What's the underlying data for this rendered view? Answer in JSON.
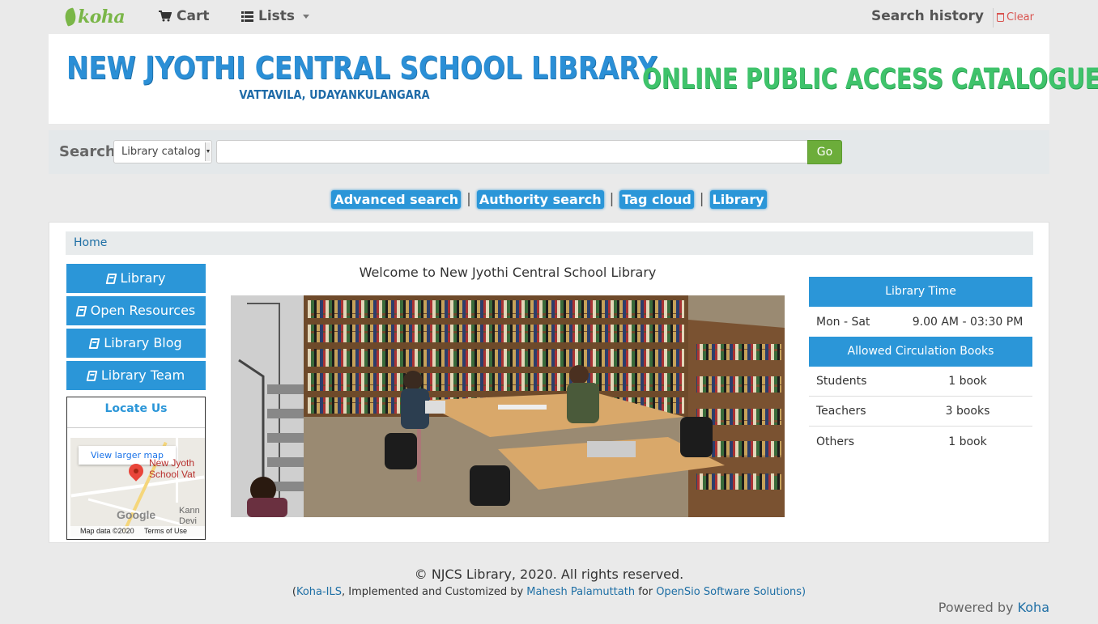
{
  "navbar": {
    "logo": "koha",
    "cart_label": "Cart",
    "lists_label": "Lists",
    "search_history_label": "Search history",
    "clear_label": "Clear"
  },
  "banner": {
    "title": "NEW JYOTHI CENTRAL SCHOOL LIBRARY",
    "subtitle": "VATTAVILA, UDAYANKULANGARA",
    "right_text": "ONLINE PUBLIC ACCESS CATALOGUE"
  },
  "search": {
    "label": "Search",
    "selected_scope": "Library catalog",
    "query_value": "",
    "go_label": "Go"
  },
  "quicklinks": [
    {
      "label": "Advanced search"
    },
    {
      "label": "Authority search"
    },
    {
      "label": "Tag cloud"
    },
    {
      "label": "Library"
    }
  ],
  "breadcrumb": {
    "home": "Home"
  },
  "sidebar": {
    "items": [
      {
        "label": "Library"
      },
      {
        "label": "Open Resources"
      },
      {
        "label": "Library Blog"
      },
      {
        "label": "Library Team"
      }
    ],
    "locate_title": "Locate Us",
    "map": {
      "button_label": "View larger map",
      "place_line1": "New Jyoth",
      "place_line2": "School Vat",
      "place2_line1": "Kann",
      "place2_line2": "Devi",
      "google": "Google",
      "map_data": "Map data ©2020",
      "terms": "Terms of Use"
    }
  },
  "main": {
    "welcome": "Welcome to New Jyothi Central School Library"
  },
  "info": {
    "time_header": "Library Time",
    "time_days": "Mon - Sat",
    "time_hours": "9.00 AM - 03:30 PM",
    "circ_header": "Allowed Circulation Books",
    "circ_rows": [
      {
        "who": "Students",
        "allowed": "1 book"
      },
      {
        "who": "Teachers",
        "allowed": "3 books"
      },
      {
        "who": "Others",
        "allowed": "1 book"
      }
    ]
  },
  "footer": {
    "copyright": "© NJCS Library, 2020. All rights reserved.",
    "open_paren": "(",
    "koha_ils": "Koha-ILS",
    "implemented": ", Implemented and Customized by ",
    "author": "Mahesh Palamuttath",
    "for": " for ",
    "company": "OpenSio Software Solutions)",
    "powered_by": "Powered by ",
    "koha": "Koha"
  },
  "colors": {
    "accent_blue": "#2b96d8",
    "go_green": "#6cad3a",
    "koha_green": "#7ab648",
    "banner_title": "#2b8fd6",
    "banner_right": "#3fc36b"
  }
}
